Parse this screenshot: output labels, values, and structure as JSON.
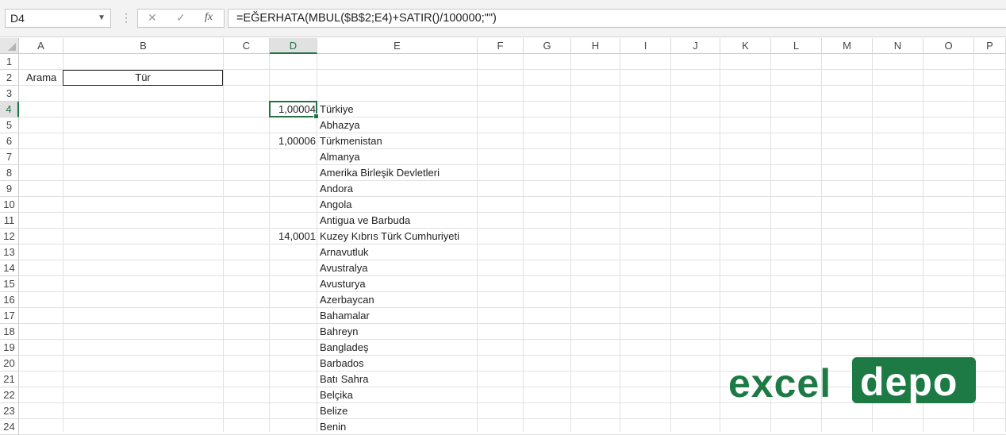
{
  "formula_bar": {
    "name_box": "D4",
    "formula": "=EĞERHATA(MBUL($B$2;E4)+SATIR()/100000;\"\")",
    "cancel_icon": "close-icon",
    "enter_icon": "check-icon",
    "function_icon": "fx-icon",
    "fx_label": "fx",
    "dots_label": "⋮"
  },
  "columns": [
    "A",
    "B",
    "C",
    "D",
    "E",
    "F",
    "G",
    "H",
    "I",
    "J",
    "K",
    "L",
    "M",
    "N",
    "O",
    "P"
  ],
  "rows": [
    "1",
    "2",
    "3",
    "4",
    "5",
    "6",
    "7",
    "8",
    "9",
    "10",
    "11",
    "12",
    "13",
    "14",
    "15",
    "16",
    "17",
    "18",
    "19",
    "20",
    "21",
    "22",
    "23",
    "24"
  ],
  "cells": {
    "A2": "Arama",
    "B2": "Tür",
    "D4": "1,00004",
    "D6": "1,00006",
    "D12": "14,0001"
  },
  "countries": [
    "Türkiye",
    "Abhazya",
    "Türkmenistan",
    "Almanya",
    "Amerika Birleşik Devletleri",
    "Andora",
    "Angola",
    "Antigua ve Barbuda",
    "Kuzey Kıbrıs Türk Cumhuriyeti",
    "Arnavutluk",
    "Avustralya",
    "Avusturya",
    "Azerbaycan",
    "Bahamalar",
    "Bahreyn",
    "Bangladeş",
    "Barbados",
    "Batı Sahra",
    "Belçika",
    "Belize",
    "Benin"
  ],
  "logo": {
    "excel": "excel",
    "depo": "depo"
  },
  "accent_color": "#217346",
  "logo_color": "#1d7a45"
}
